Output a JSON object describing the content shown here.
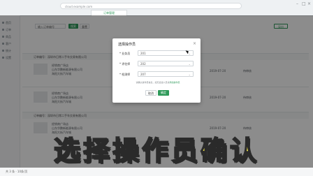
{
  "browser": {
    "url": "cloud.example.com",
    "tab_title": "订单管理"
  },
  "sidebar": {
    "items": [
      {
        "label": "首页"
      },
      {
        "label": "订单"
      },
      {
        "label": "商品"
      },
      {
        "label": "客户"
      },
      {
        "label": "统计"
      },
      {
        "label": "设置"
      }
    ]
  },
  "filters": {
    "select_label": "输入订单编号",
    "search_label": "搜索",
    "reset_label": "重置",
    "export_label": "导出"
  },
  "orders": [
    {
      "header": "订单编号：深圳市日常二手车交易有限公司",
      "line1": "经销商广场店",
      "line2": "山东华鹏新能源有限公司",
      "line3": "海阳大街汽车城",
      "date": "2019-07-20",
      "status": "待审核"
    },
    {
      "header": "",
      "line1": "经销商广场店",
      "line2": "山东华鹏新能源有限公司",
      "line3": "海阳大街汽车城",
      "date": "2019-07-20",
      "status": "待审核"
    },
    {
      "header": "订单编号：深圳市日常二手车交易有限公司",
      "line1": "经销商广场店",
      "line2": "山东华鹏新能源有限公司",
      "line3": "海阳大街汽车城",
      "date": "2019-07-20",
      "status": "待审核"
    }
  ],
  "dialog": {
    "title": "选择操作员",
    "close_glyph": "×",
    "fields": [
      {
        "label": "* 业务员",
        "value": "201"
      },
      {
        "label": "* 评估师",
        "value": "202"
      },
      {
        "label": "* 检测师",
        "value": "207"
      }
    ],
    "note_text": "请确认操作员信息，如无合适人员请",
    "note_link": "添加操作员",
    "cancel_label": "取消",
    "ok_label": "确定"
  },
  "subtitle": "选择操作员确认",
  "footer": "共 3 条  ·  10条/页",
  "colors": {
    "accent": "#2f9a5a",
    "subtitle": "#f3e84a"
  },
  "icons": [
    "close-icon",
    "chevron-down-icon",
    "cursor-icon"
  ]
}
